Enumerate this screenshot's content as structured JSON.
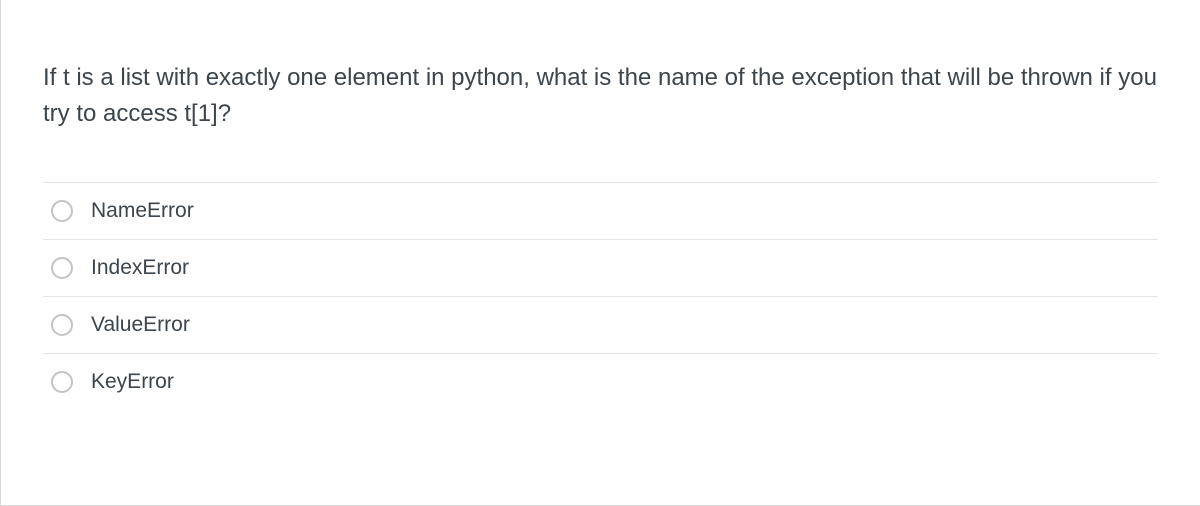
{
  "question": {
    "text": "If t is a list with exactly one element in python, what is the name of the exception that will be thrown if you try to access t[1]?"
  },
  "options": [
    {
      "label": "NameError"
    },
    {
      "label": "IndexError"
    },
    {
      "label": "ValueError"
    },
    {
      "label": "KeyError"
    }
  ]
}
